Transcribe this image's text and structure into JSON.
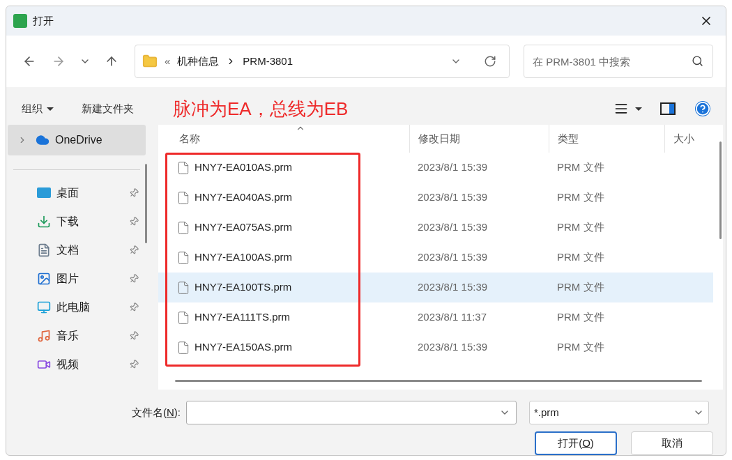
{
  "window": {
    "title": "打开"
  },
  "address": {
    "overflow": "«",
    "path": [
      "机种信息",
      "PRM-3801"
    ]
  },
  "search": {
    "placeholder": "在 PRM-3801 中搜索"
  },
  "toolbar": {
    "organize": "组织",
    "new_folder": "新建文件夹"
  },
  "annotation": "脉冲为EA，总线为EB",
  "sidebar": {
    "items": [
      {
        "label": "OneDrive",
        "kind": "cloud",
        "selected": true,
        "pinned": false
      },
      {
        "label": "桌面",
        "kind": "desktop",
        "selected": false,
        "pinned": true
      },
      {
        "label": "下载",
        "kind": "download",
        "selected": false,
        "pinned": true
      },
      {
        "label": "文档",
        "kind": "document",
        "selected": false,
        "pinned": true
      },
      {
        "label": "图片",
        "kind": "image",
        "selected": false,
        "pinned": true
      },
      {
        "label": "此电脑",
        "kind": "computer",
        "selected": false,
        "pinned": true
      },
      {
        "label": "音乐",
        "kind": "music",
        "selected": false,
        "pinned": true
      },
      {
        "label": "视频",
        "kind": "video",
        "selected": false,
        "pinned": true
      }
    ]
  },
  "table": {
    "columns": [
      "名称",
      "修改日期",
      "类型",
      "大小"
    ],
    "rows": [
      {
        "name": "HNY7-EA010AS.prm",
        "modified": "2023/8/1 15:39",
        "type": "PRM 文件",
        "selected": false
      },
      {
        "name": "HNY7-EA040AS.prm",
        "modified": "2023/8/1 15:39",
        "type": "PRM 文件",
        "selected": false
      },
      {
        "name": "HNY7-EA075AS.prm",
        "modified": "2023/8/1 15:39",
        "type": "PRM 文件",
        "selected": false
      },
      {
        "name": "HNY7-EA100AS.prm",
        "modified": "2023/8/1 15:39",
        "type": "PRM 文件",
        "selected": false
      },
      {
        "name": "HNY7-EA100TS.prm",
        "modified": "2023/8/1 15:39",
        "type": "PRM 文件",
        "selected": true
      },
      {
        "name": "HNY7-EA111TS.prm",
        "modified": "2023/8/1 11:37",
        "type": "PRM 文件",
        "selected": false
      },
      {
        "name": "HNY7-EA150AS.prm",
        "modified": "2023/8/1 15:39",
        "type": "PRM 文件",
        "selected": false
      }
    ]
  },
  "footer": {
    "filename_label": [
      "文件名(",
      "N",
      "):"
    ],
    "filter": "*.prm",
    "open_button": [
      "打开(",
      "O",
      ")"
    ],
    "cancel_button": "取消"
  }
}
